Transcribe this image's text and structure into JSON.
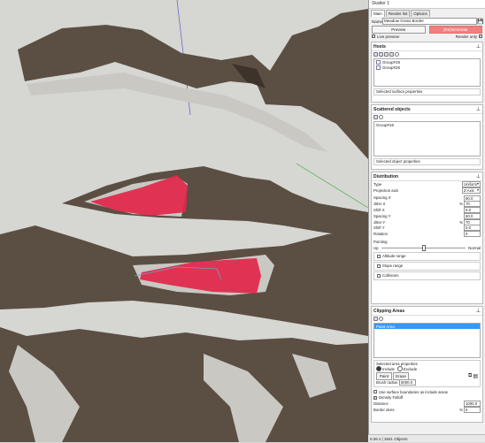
{
  "viewport": {
    "ground_color": "#d6d6d2",
    "terrain_color": "#5b4e43",
    "strip_color": "#c9c8c3",
    "scatter_color": "#e2264a",
    "selection_color": "#6aa0c8"
  },
  "panel": {
    "title": "Skatter 1",
    "tabs": [
      "Main",
      "Render list",
      "Options"
    ],
    "name_label": "Name",
    "name_value": "Meadow Grass Border",
    "preview_label": "Preview",
    "regenerate_label": "(Re)Generate",
    "live_preview_label": "Live preview",
    "render_only_label": "Render only",
    "hosts": {
      "title": "Hosts",
      "items": [
        "Group#19",
        "Group#26"
      ],
      "subprop_label": "Selected surface properties"
    },
    "scattered": {
      "title": "Scattered objects",
      "items": [
        "Group#16"
      ],
      "subprop_label": "Selected object properties"
    },
    "distribution": {
      "title": "Distribution",
      "type_label": "Type",
      "type_value": "Uniform",
      "projection_label": "Projection axis",
      "projection_value": "Z Axis",
      "fields": [
        {
          "label": "Spacing X",
          "unit": "",
          "value": "60.0"
        },
        {
          "label": "Jitter X",
          "unit": "%",
          "value": "70"
        },
        {
          "label": "Shift X",
          "unit": "",
          "value": "0.0"
        },
        {
          "label": "Spacing Y",
          "unit": "",
          "value": "60.0"
        },
        {
          "label": "Jitter Y",
          "unit": "%",
          "value": "70"
        },
        {
          "label": "Shift Y",
          "unit": "",
          "value": "0.0"
        },
        {
          "label": "Rotation",
          "unit": "",
          "value": "0"
        }
      ],
      "pointing_label": "Pointing",
      "pointing_left": "Up",
      "pointing_right": "Normal",
      "pointing_level": 0.5,
      "groups": [
        "Altitude range",
        "Slope range",
        "Collisions"
      ]
    },
    "clipping": {
      "title": "Clipping Areas",
      "items": [
        "Paint Area"
      ],
      "subprop_label": "Selected area properties",
      "include_label": "Include",
      "exclude_label": "Exclude",
      "paint_label": "Paint",
      "erase_label": "Erase",
      "brush_radius_label": "Brush radius",
      "brush_radius_value": "5000.0",
      "use_boundaries_label": "Use surface boundaries as include areas",
      "density_falloff_label": "Density Falloff",
      "distance_label": "Distance",
      "distance_value": "1000.0",
      "border_dens_label": "Border dens.",
      "border_dens_unit": "%",
      "border_dens_value": "5"
    }
  },
  "status": "0.26 s | 1841 Objects"
}
